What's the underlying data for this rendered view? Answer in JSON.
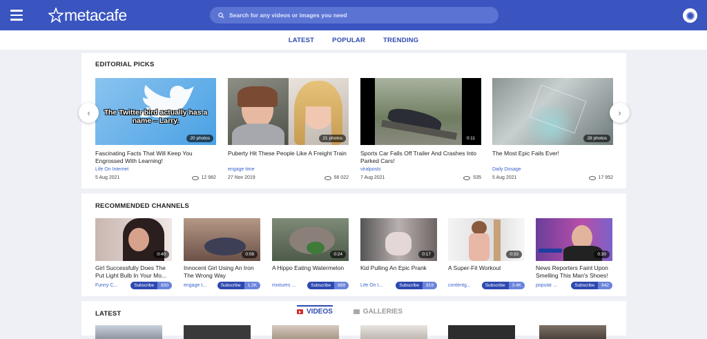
{
  "header": {
    "logo_text": "metacafe",
    "search_placeholder": "Search for any videos or images you need",
    "menu_icon": "hamburger-icon",
    "user_icon": "user-avatar-icon",
    "brand_color": "#3a55c0"
  },
  "subnav": [
    "LATEST",
    "POPULAR",
    "TRENDING"
  ],
  "editorial": {
    "heading": "EDITORIAL PICKS",
    "prev_icon": "chevron-left-icon",
    "next_icon": "chevron-right-icon",
    "cards": [
      {
        "title": "Fascinating Facts That Will Keep You Engrossed With Learning!",
        "channel": "Life On Internet",
        "date": "5 Aug 2021",
        "views": "12 982",
        "badge": "20 photos",
        "overlay_text": "The Twitter bird actually has a name – Larry."
      },
      {
        "title": "Puberty Hit These People Like A Freight Train",
        "channel": "engage time",
        "date": "27 Nov 2019",
        "views": "56 022",
        "badge": "21 photos"
      },
      {
        "title": "Sports Car Falls Off Trailer And Crashes Into Parked Cars!",
        "channel": "viralposts",
        "date": "7 Aug 2021",
        "views": "535",
        "badge": "0:11"
      },
      {
        "title": "The Most Epic Fails Ever!",
        "channel": "Daily Dosage",
        "date": "5 Aug 2021",
        "views": "17 952",
        "badge": "28 photos"
      }
    ]
  },
  "recommended": {
    "heading": "RECOMMENDED CHANNELS",
    "subscribe_label": "Subscribe",
    "cards": [
      {
        "title": "Girl Successfully Does The Put Light Bulb In Your Mo...",
        "channel": "Funny C...",
        "count": "830",
        "duration": "0:40"
      },
      {
        "title": "Innocent Girl Using An Iron The Wrong Way",
        "channel": "engage t...",
        "count": "1.2K",
        "duration": "0:08"
      },
      {
        "title": "A Hippo Eating Watermelon",
        "channel": "mixtures ...",
        "count": "889",
        "duration": "0:24"
      },
      {
        "title": "Kid Pulling An Epic Prank",
        "channel": "Life On I...",
        "count": "819",
        "duration": "0:17"
      },
      {
        "title": "A Super-Fit Workout",
        "channel": "contentg...",
        "count": "3.4K",
        "duration": "0:33"
      },
      {
        "title": "News Reporters Faint Upon Smelling This Man's Shoes!",
        "channel": "popular ...",
        "count": "842",
        "duration": "0:30"
      }
    ]
  },
  "latest": {
    "heading": "LATEST",
    "tab_videos": "VIDEOS",
    "tab_galleries": "GALLERIES"
  }
}
